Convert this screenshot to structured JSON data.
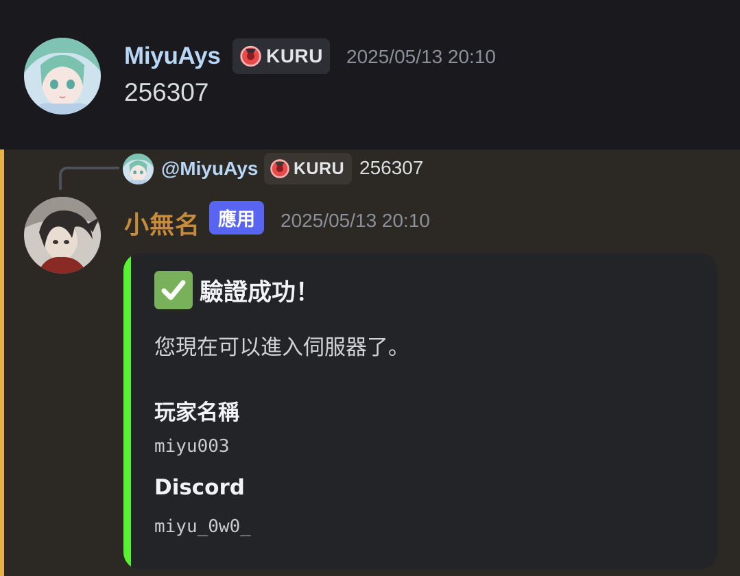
{
  "message_1": {
    "author": "MiyuAys",
    "tag": "KURU",
    "timestamp": "2025/05/13 20:10",
    "content": "256307",
    "avatar_icon": "anime-avatar-green-hair"
  },
  "message_2": {
    "reply": {
      "mention": "@MiyuAys",
      "tag": "KURU",
      "content": "256307"
    },
    "author": "小無名",
    "app_badge": "應用",
    "timestamp": "2025/05/13 20:10",
    "avatar_icon": "anime-avatar-dark-hair",
    "embed": {
      "title_icon": "check-mark-icon",
      "title": "驗證成功！",
      "description": "您現在可以進入伺服器了。",
      "fields": [
        {
          "name": "玩家名稱",
          "value": "miyu003"
        },
        {
          "name": "Discord",
          "value": "miyu_0w0_"
        }
      ]
    }
  },
  "colors": {
    "background": "#1a1a1e",
    "mention_highlight": "#2c2925",
    "mention_stripe": "#e6b04a",
    "author_1": "#b8d6f5",
    "author_2": "#c78b3c",
    "app_badge": "#5865f2",
    "embed_bar": "#57f331",
    "embed_bg": "#232428"
  }
}
